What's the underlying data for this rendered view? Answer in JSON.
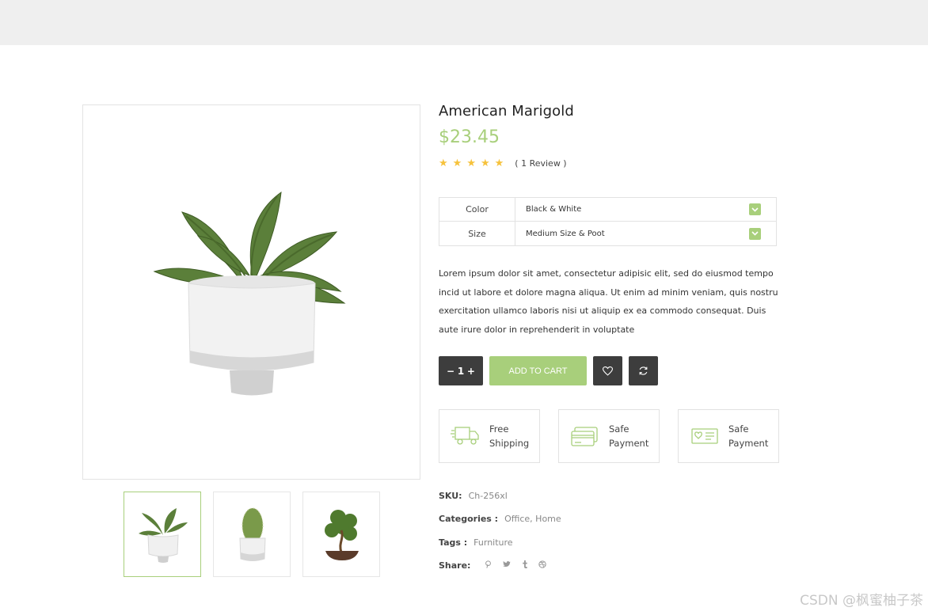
{
  "product": {
    "title": "American Marigold",
    "price": "$23.45",
    "rating_stars": 5,
    "review_text": "( 1 Review )"
  },
  "options": [
    {
      "label": "Color",
      "value": "Black & White"
    },
    {
      "label": "Size",
      "value": "Medium Size & Poot"
    }
  ],
  "description": "Lorem ipsum dolor sit amet, consectetur adipisic elit, sed do eiusmod tempo incid ut labore et dolore magna aliqua. Ut enim ad minim veniam, quis nostru exercitation ullamco laboris nisi ut aliquip ex ea commodo consequat. Duis aute irure dolor in reprehenderit in voluptate",
  "cart": {
    "qty_minus": "−",
    "qty_value": "1",
    "qty_plus": "+",
    "add_label": "ADD TO CART"
  },
  "features": [
    {
      "icon": "truck-icon",
      "line1": "Free",
      "line2": "Shipping"
    },
    {
      "icon": "card-icon",
      "line1": "Safe",
      "line2": "Payment"
    },
    {
      "icon": "gift-card-icon",
      "line1": "Safe",
      "line2": "Payment"
    }
  ],
  "meta": {
    "sku_label": "SKU:",
    "sku_value": "Ch-256xl",
    "categories_label": "Categories :",
    "categories_value": "Office, Home",
    "tags_label": "Tags :",
    "tags_value": "Furniture",
    "share_label": "Share:"
  },
  "watermark": "CSDN @枫蜜柚子茶",
  "colors": {
    "accent": "#a8cf7b",
    "dark_button": "#3d3d3d",
    "star": "#f6c23c",
    "topbar": "#efefef"
  }
}
